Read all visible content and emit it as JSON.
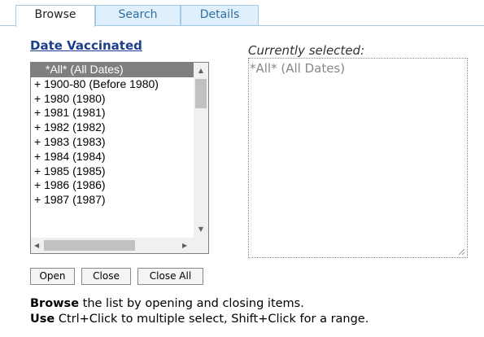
{
  "tabs": [
    {
      "label": "Browse",
      "active": true
    },
    {
      "label": "Search",
      "active": false
    },
    {
      "label": "Details",
      "active": false
    }
  ],
  "browse": {
    "field_title": "Date Vaccinated",
    "list_items": [
      "*All* (All Dates)",
      "+ 1900-80  (Before 1980)",
      "+ 1980  (1980)",
      "+ 1981  (1981)",
      "+ 1982  (1982)",
      "+ 1983  (1983)",
      "+ 1984  (1984)",
      "+ 1985  (1985)",
      "+ 1986  (1986)",
      "+ 1987  (1987)"
    ],
    "selected_index": 0,
    "currently_selected_label": "Currently selected:",
    "currently_selected_value": "*All* (All Dates)",
    "buttons": {
      "open": "Open",
      "close": "Close",
      "close_all": "Close All"
    },
    "help": {
      "line1_bold": "Browse",
      "line1_rest": " the list by opening and closing items.",
      "line2_bold": "Use",
      "line2_rest": " Ctrl+Click to multiple select, Shift+Click for a range."
    }
  },
  "colors": {
    "tab_border": "#a6c9e2",
    "tab_inactive_bg": "#dfeffc",
    "tab_inactive_text": "#2e6e9e",
    "title_link": "#1b3f8b",
    "selected_row_bg": "#7f7f7f"
  }
}
